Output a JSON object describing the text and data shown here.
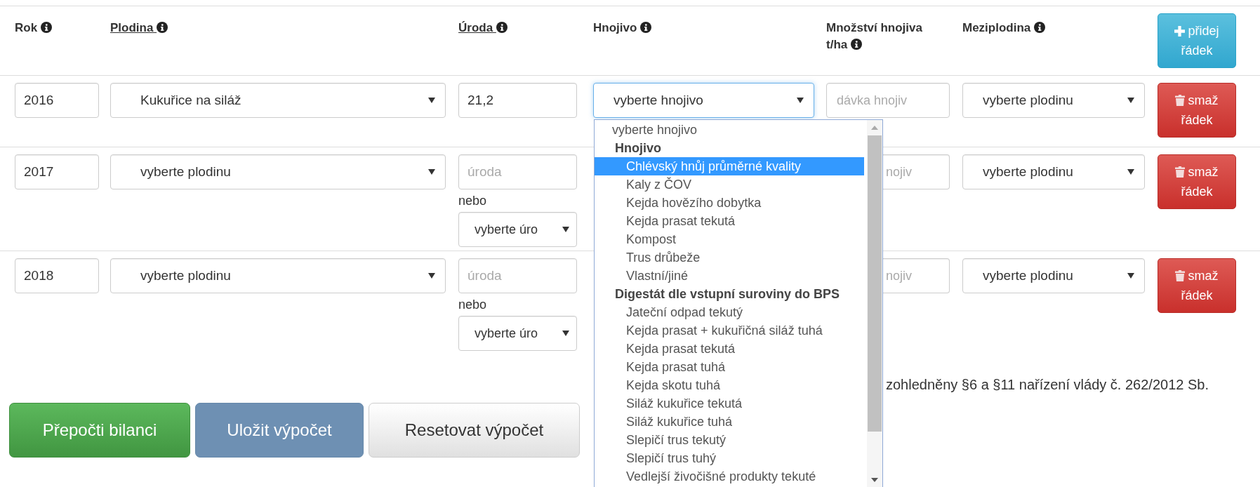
{
  "columns": [
    {
      "label": "Rok",
      "link": false
    },
    {
      "label": "Plodina",
      "link": true
    },
    {
      "label": "Úroda",
      "link": true
    },
    {
      "label": "Hnojivo",
      "link": false
    },
    {
      "label": "Množství hnojiva t/ha",
      "link": false
    },
    {
      "label": "Meziplodina",
      "link": false
    }
  ],
  "add_row_button": {
    "label": "přidej řádek"
  },
  "rows": [
    {
      "year": "2016",
      "crop": "Kukuřice na siláž",
      "yield": {
        "value": "21,2"
      },
      "fertilizer": {
        "value": "vyberte hnojivo",
        "focused": true
      },
      "dose": {
        "placeholder": "dávka hnojiv",
        "covered": false
      },
      "catch_crop": "vyberte plodinu",
      "delete_button": "smaž řádek"
    },
    {
      "year": "2017",
      "crop": "vyberte plodinu",
      "yield": {
        "placeholder": "úroda",
        "or_label": "nebo",
        "select": "vyberte úro"
      },
      "dose": {
        "placeholder": "nojiv",
        "covered": true
      },
      "catch_crop": "vyberte plodinu",
      "delete_button": "smaž řádek"
    },
    {
      "year": "2018",
      "crop": "vyberte plodinu",
      "yield": {
        "placeholder": "úroda",
        "or_label": "nebo",
        "select": "vyberte úro"
      },
      "dose": {
        "placeholder": "nojiv",
        "covered": true
      },
      "catch_crop": "vyberte plodinu",
      "delete_button": "smaž řádek"
    }
  ],
  "fertilizer_dropdown": {
    "options": [
      {
        "label": "vyberte hnojivo",
        "kind": "placeholder",
        "selected": false
      },
      {
        "label": "Hnojivo",
        "kind": "group"
      },
      {
        "label": "Chlévský hnůj průměrné kvality",
        "kind": "option",
        "selected": true
      },
      {
        "label": "Kaly z ČOV",
        "kind": "option",
        "selected": false
      },
      {
        "label": "Kejda hovězího dobytka",
        "kind": "option",
        "selected": false
      },
      {
        "label": "Kejda prasat tekutá",
        "kind": "option",
        "selected": false
      },
      {
        "label": "Kompost",
        "kind": "option",
        "selected": false
      },
      {
        "label": "Trus drůbeže",
        "kind": "option",
        "selected": false
      },
      {
        "label": "Vlastní/jiné",
        "kind": "option",
        "selected": false
      },
      {
        "label": "Digestát dle vstupní suroviny do BPS",
        "kind": "group"
      },
      {
        "label": "Jateční odpad tekutý",
        "kind": "option",
        "selected": false
      },
      {
        "label": "Kejda prasat + kukuřičná siláž tuhá",
        "kind": "option",
        "selected": false
      },
      {
        "label": "Kejda prasat tekutá",
        "kind": "option",
        "selected": false
      },
      {
        "label": "Kejda prasat tuhá",
        "kind": "option",
        "selected": false
      },
      {
        "label": "Kejda skotu tuhá",
        "kind": "option",
        "selected": false
      },
      {
        "label": "Siláž kukuřice tekutá",
        "kind": "option",
        "selected": false
      },
      {
        "label": "Siláž kukuřice tuhá",
        "kind": "option",
        "selected": false
      },
      {
        "label": "Slepičí trus tekutý",
        "kind": "option",
        "selected": false
      },
      {
        "label": "Slepičí trus tuhý",
        "kind": "option",
        "selected": false
      },
      {
        "label": "Vedlejší živočišné produkty tekuté",
        "kind": "option",
        "selected": false
      }
    ]
  },
  "note": "zohledněny §6 a §11 nařízení vlády č. 262/2012 Sb.",
  "actions": [
    {
      "label": "Přepočti bilanci",
      "kind": "success"
    },
    {
      "label": "Uložit výpočet",
      "kind": "primary"
    },
    {
      "label": "Resetovat výpočet",
      "kind": "default"
    }
  ]
}
